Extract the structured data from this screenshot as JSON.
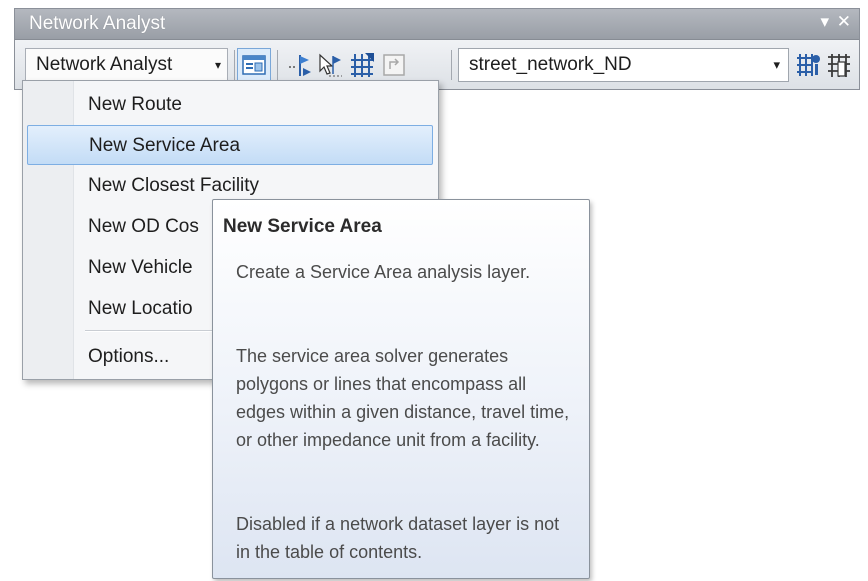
{
  "window": {
    "title": "Network Analyst",
    "dropdown_glyph": "▾",
    "close_glyph": "✕"
  },
  "toolbar": {
    "menu_label": "Network Analyst",
    "caret": "▾",
    "network_dataset": "street_network_ND",
    "combo_arrow": "▾",
    "icons": [
      "network-analyst-window-icon",
      "create-network-location-tool-icon",
      "select-move-network-locations-icon",
      "solve-icon",
      "directions-window-icon",
      "build-network-dataset-icon",
      "network-identify-icon"
    ]
  },
  "menu": {
    "items": [
      "New Route",
      "New Service Area",
      "New Closest Facility",
      "New OD Cos",
      "New Vehicle",
      "New Locatio"
    ],
    "options": "Options...",
    "highlighted_index": 1
  },
  "tooltip": {
    "title": "New Service Area",
    "summary": "Create a Service Area analysis layer.",
    "description": "The service area solver generates polygons or lines that encompass all edges within a given distance, travel time, or other impedance unit from a facility.",
    "disabled_note": "Disabled if a network dataset layer is not in the table of contents."
  },
  "colors": {
    "titlebar": "#a6abb3",
    "highlight": "#c3dcf6",
    "highlight_border": "#7daee3",
    "tooltip_bottom": "#dde5f2"
  }
}
